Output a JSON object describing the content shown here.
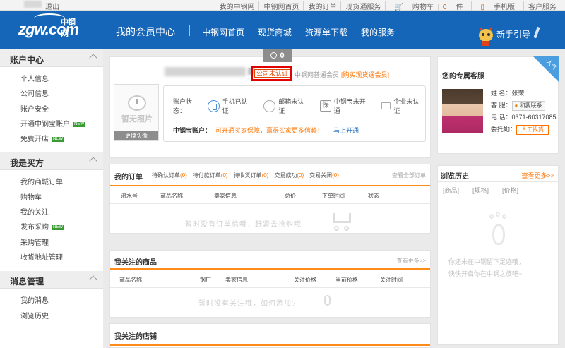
{
  "topbar": {
    "logout": "退出",
    "links": [
      "我的中钢网",
      "中钢网首页",
      "我的订单",
      "现货通服务",
      "购物车",
      "0",
      "件",
      "手机版",
      "客户服务"
    ]
  },
  "header": {
    "logo": "zgw.com",
    "logo_cn": "中钢网",
    "title": "我的会员中心",
    "nav": [
      "中钢网首页",
      "现货商城",
      "资源单下载",
      "我的服务"
    ],
    "guide": "新手引导"
  },
  "sidebar": {
    "sections": [
      {
        "title": "账户中心",
        "items": [
          "个人信息",
          "公司信息",
          "账户安全",
          "开通中钢宝账户",
          "免费开店"
        ]
      },
      {
        "title": "我是买方",
        "items": [
          "我的商城订单",
          "购物车",
          "我的关注",
          "发布采购",
          "采购管理",
          "收货地址管理"
        ]
      },
      {
        "title": "消息管理",
        "items": [
          "我的消息",
          "浏览历史"
        ]
      }
    ],
    "new_badge": "NEW"
  },
  "profile": {
    "badge_count": "0",
    "unverified": "公司未认证",
    "member": "中钢网普通会员",
    "buy_vip": "[购买现货通会员]",
    "photo_text": "暂无照片",
    "change_avatar": "更换头像",
    "status_label": "账户状态：",
    "phone": "手机已认证",
    "email": "邮箱未认证",
    "bao": "保",
    "bao_text": "中钢宝未开通",
    "company": "企业未认证",
    "zgb_label": "中钢宝账户：",
    "zgb_warn": "可开通买家保障，赢得买家更多信赖！",
    "zgb_link": "马上开通"
  },
  "service": {
    "corner": "人气",
    "title": "您的专属客服",
    "name": "姓  名：张荣",
    "kefu_label": "客  服：",
    "kefu_btn": "和我联系",
    "phone": "电  话：0371-60317085",
    "trust_label": "委托她：",
    "trust_btn": "人工找货"
  },
  "history": {
    "title": "浏览历史",
    "more": "查看更多>>",
    "cols": [
      "[商品]",
      "[规格]",
      "[价格]"
    ],
    "empty1": "你还未在中钢留下足迹哦，",
    "empty2": "快快开启你在中钢之旅吧~"
  },
  "orders": {
    "title": "我的订单",
    "tabs": [
      {
        "label": "待确认订单",
        "count": "(0)"
      },
      {
        "label": "待付款订单",
        "count": "(0)"
      },
      {
        "label": "待收货订单",
        "count": "(0)"
      },
      {
        "label": "交易成功",
        "count": "(0)"
      },
      {
        "label": "交易关闭",
        "count": "(0)"
      }
    ],
    "all": "查看全部订单",
    "cols": [
      "流水号",
      "商品名称",
      "卖家信息",
      "总价",
      "下单时间",
      "状态"
    ],
    "empty": "暂时没有订单信哦，赶紧去抢购哦~"
  },
  "fav": {
    "title": "我关注的商品",
    "more": "查看更多>>",
    "cols": [
      "商品名称",
      "钢厂",
      "卖家信息",
      "关注价格",
      "当前价格",
      "关注时间"
    ],
    "empty": "暂时没有关注哦，如何添加?"
  },
  "shop": {
    "title": "我关注的店铺"
  }
}
